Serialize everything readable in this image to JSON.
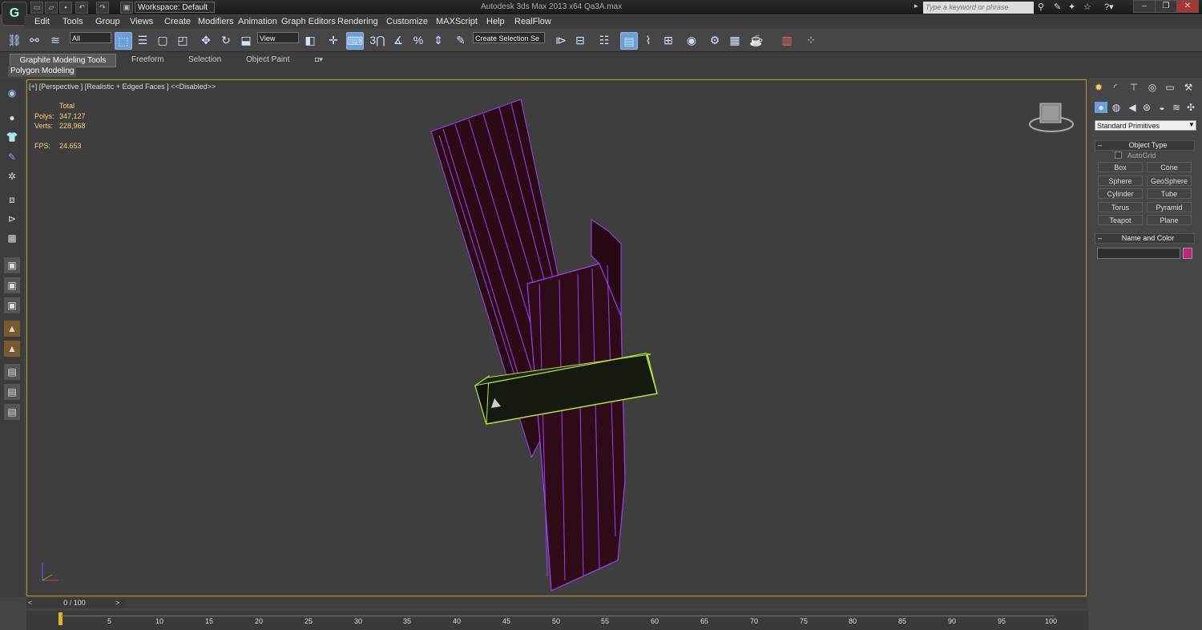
{
  "titlebar": {
    "workspace": "Workspace: Default",
    "title": "Autodesk 3ds Max  2013 x64      Qa3A.max",
    "search_placeholder": "Type a keyword or phrase"
  },
  "menu": [
    "Edit",
    "Tools",
    "Group",
    "Views",
    "Create",
    "Modifiers",
    "Animation",
    "Graph Editors",
    "Rendering",
    "Customize",
    "MAXScript",
    "Help",
    "RealFlow"
  ],
  "toolbar": {
    "selection_filter": "All",
    "ref_coord": "View",
    "named_selection": "Create Selection Se",
    "snap_label": "3"
  },
  "ribbon": {
    "tabs": [
      "Graphite Modeling Tools",
      "Freeform",
      "Selection",
      "Object Paint"
    ],
    "subpanel": "Polygon Modeling"
  },
  "viewport": {
    "label": "[+] [Perspective ] [Realistic + Edged Faces ]  <<Disabled>>",
    "stats": {
      "total_label": "Total",
      "polys_label": "Polys:",
      "polys_value": "347,127",
      "verts_label": "Verts:",
      "verts_value": "228,968",
      "fps_label": "FPS:",
      "fps_value": "24.653"
    },
    "selection_color": "#b5e23a",
    "mesh_edge_color": "#a43cff"
  },
  "command_panel": {
    "category": "Standard Primitives",
    "object_type_title": "Object Type",
    "autogrid_label": "AutoGrid",
    "buttons": [
      "Box",
      "Cone",
      "Sphere",
      "GeoSphere",
      "Cylinder",
      "Tube",
      "Torus",
      "Pyramid",
      "Teapot",
      "Plane"
    ],
    "name_color_title": "Name and Color",
    "object_color": "#c2237e"
  },
  "timeline": {
    "frame_display": "0 / 100",
    "ticks": [
      "5",
      "10",
      "15",
      "20",
      "25",
      "30",
      "35",
      "40",
      "45",
      "50",
      "55",
      "60",
      "65",
      "70",
      "75",
      "80",
      "85",
      "90",
      "95",
      "100"
    ]
  }
}
